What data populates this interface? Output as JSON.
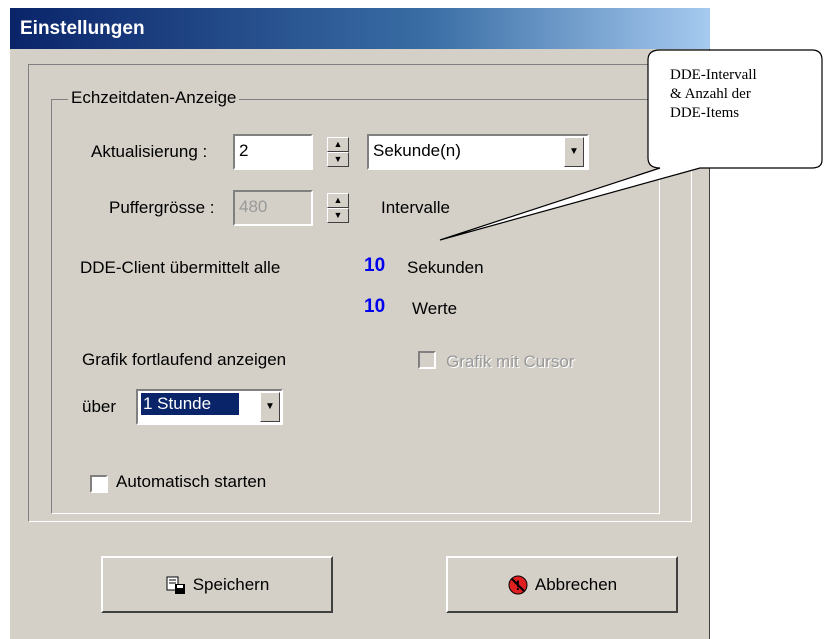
{
  "window": {
    "title": "Einstellungen"
  },
  "group": {
    "legend": "Echzeitdaten-Anzeige",
    "update_label": "Aktualisierung :",
    "update_value": "2",
    "unit_value": "Sekunde(n)",
    "buffer_label": "Puffergrösse :",
    "buffer_value": "480",
    "buffer_unit": "Intervalle",
    "dde_text": "DDE-Client übermittelt alle",
    "dde_seconds_value": "10",
    "dde_seconds_unit": "Sekunden",
    "dde_values_value": "10",
    "dde_values_unit": "Werte",
    "graph_label": "Grafik fortlaufend anzeigen",
    "cursor_label": "Grafik mit Cursor",
    "over_label": "über",
    "over_value": "1 Stunde",
    "autostart_label": "Automatisch starten"
  },
  "buttons": {
    "save": "Speichern",
    "cancel": "Abbrechen"
  },
  "callout": {
    "line1": "DDE-Intervall",
    "line2": "& Anzahl der",
    "line3": "DDE-Items"
  },
  "colors": {
    "title_start": "#0a246a",
    "title_end": "#a6caf0",
    "value_blue": "#0000ee",
    "face": "#d4d0c8"
  }
}
